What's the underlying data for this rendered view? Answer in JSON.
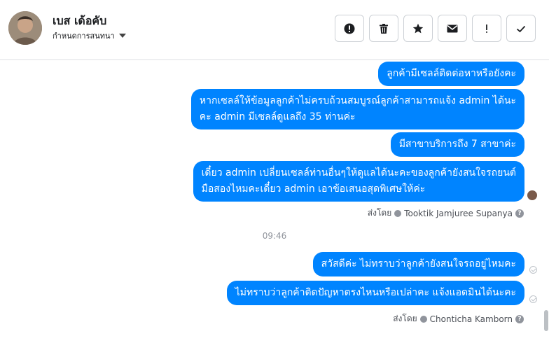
{
  "contact": {
    "name": "เบส เด้อคับ",
    "subtitle": "กำหนดการสนทนา"
  },
  "actions": [
    {
      "icon": "exclamation-circle-icon",
      "name": "report"
    },
    {
      "icon": "trash-icon",
      "name": "delete"
    },
    {
      "icon": "star-icon",
      "name": "star"
    },
    {
      "icon": "envelope-icon",
      "name": "mark-unread"
    },
    {
      "icon": "exclamation-icon",
      "name": "spam"
    },
    {
      "icon": "checkmark-icon",
      "name": "done"
    }
  ],
  "messages": {
    "m1": "ลูกค้ามีเซลล์ติดต่อหาหรือยังคะ",
    "m2_line1": "หากเซลล์ให้ข้อมูลลูกค้าไม่ครบถ้วนสมบูรณ์ลูกค้าสามารถแจ้ง admin ได้นะ",
    "m2_line2": "คะ admin มีเซลล์ดูแลถึง 35 ท่านค่ะ",
    "m3": "มีสาขาบริการถึง 7 สาขาค่ะ",
    "m4_line1": "เดี๋ยว admin เปลี่ยนเซลล์ท่านอื่นๆให้ดูแลได้นะคะของลูกค้ายังสนใจรถยนต์",
    "m4_line2": "มือสองไหมคะเดี๋ยว admin เอาข้อเสนอสุดพิเศษให้ค่ะ",
    "sent_by_1_prefix": "ส่งโดย",
    "sent_by_1_name": "Tooktik Jamjuree Supanya",
    "time": "09:46",
    "m5": "สวัสดีค่ะ ไม่ทราบว่าลูกค้ายังสนใจรถอยู่ไหมคะ",
    "m6": "ไม่ทราบว่าลูกค้าติดปัญหาตรงไหนหรือเปล่าคะ แจ้งแอดมินได้นะคะ",
    "sent_by_2_prefix": "ส่งโดย",
    "sent_by_2_name": "Chonticha Kamborn"
  },
  "colors": {
    "bubble": "#0084ff",
    "meta_text": "#4b4f56"
  }
}
